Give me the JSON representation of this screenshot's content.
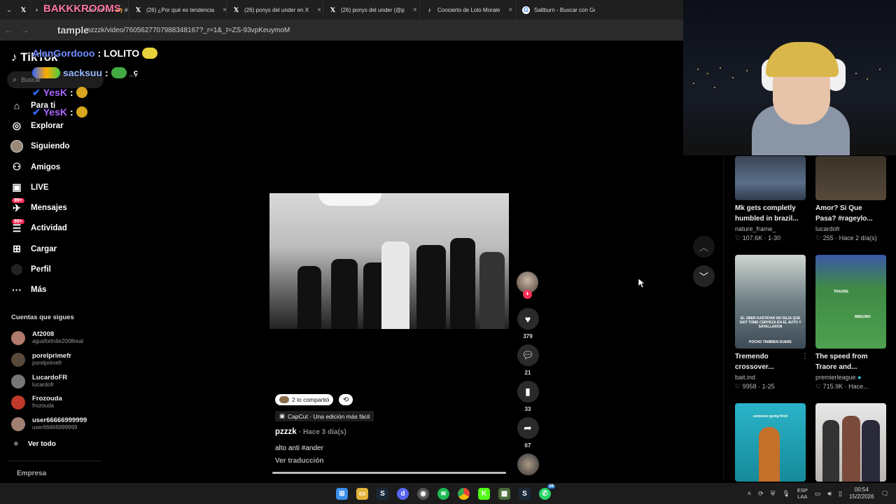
{
  "browser": {
    "tabs": [
      {
        "icon": "x-logo-icon",
        "label": "",
        "color": "#000000"
      },
      {
        "icon": "x-logo-icon",
        "label": "acerobulto 🙌 #en",
        "color": "#000000"
      },
      {
        "icon": "x-logo-icon",
        "label": "(26) ¿Por qué es tendencia",
        "color": "#000000"
      },
      {
        "icon": "x-logo-icon",
        "label": "(26) ponys del under en X",
        "color": "#000000"
      },
      {
        "icon": "x-logo-icon",
        "label": "(26) ponys del under (@p",
        "color": "#000000"
      },
      {
        "icon": "tiktok-icon",
        "label": "Concierto de Lolo Morale",
        "color": "#000000"
      },
      {
        "icon": "google-icon",
        "label": "Saltburn - Buscar con Go",
        "color": "#4285f4"
      }
    ],
    "url": "…pzzzk/video/7605627707988348167?_r=1&_t=ZS-93vpKeuymoM"
  },
  "overlay": {
    "stream_name": "BAKKKROOMS",
    "stream_name2": "tample",
    "chat": [
      {
        "user": "AlanGordooo",
        "message": "LOLITO"
      },
      {
        "user": "sacksuu",
        "message": "_ç"
      },
      {
        "user": "YesK",
        "message": ""
      },
      {
        "user": "YesK",
        "message": ""
      }
    ]
  },
  "sidebar": {
    "logo": "TikTok",
    "search_placeholder": "Buscar",
    "nav": [
      {
        "icon": "home-icon",
        "label": "Para ti",
        "badge": ""
      },
      {
        "icon": "compass-icon",
        "label": "Explorar",
        "badge": ""
      },
      {
        "icon": "avatar-icon",
        "label": "Siguiendo",
        "badge": ""
      },
      {
        "icon": "friends-icon",
        "label": "Amigos",
        "badge": ""
      },
      {
        "icon": "live-icon",
        "label": "LIVE",
        "badge": ""
      },
      {
        "icon": "messages-icon",
        "label": "Mensajes",
        "badge": "99+"
      },
      {
        "icon": "activity-icon",
        "label": "Actividad",
        "badge": "99+"
      },
      {
        "icon": "upload-icon",
        "label": "Cargar",
        "badge": ""
      },
      {
        "icon": "profile-icon",
        "label": "Perfil",
        "badge": ""
      },
      {
        "icon": "more-icon",
        "label": "Más",
        "badge": ""
      }
    ],
    "following_title": "Cuentas que sigues",
    "following": [
      {
        "name": "Af2008",
        "user": "agusfortnite2008real",
        "color": "#b07a6a"
      },
      {
        "name": "porelprimefr",
        "user": "porelprimefr",
        "color": "#5a4a3a"
      },
      {
        "name": "LucardoFR",
        "user": "lucardofr",
        "color": "#777777"
      },
      {
        "name": "Frozouda",
        "user": "frozouda",
        "color": "#c0392b"
      },
      {
        "name": "user66666999999",
        "user": "user66666999999",
        "color": "#a08070"
      }
    ],
    "see_all": "Ver todo",
    "company": "Empresa"
  },
  "video": {
    "shared_text": "2 lo compartió",
    "capcut_text": "CapCut · Una edición más fácil",
    "author": "pzzzk",
    "posted": "· Hace 3 día(s)",
    "caption": "alto anti #ander",
    "translate": "Ver traducción",
    "progress_fraction": 1.0,
    "likes": "379",
    "comments": "21",
    "saves": "33",
    "shares": "67"
  },
  "recommendations": [
    {
      "title": "Mk gets completly humbled in brazil...",
      "user": "nature_frame_",
      "stats": "107.6K · 1-30",
      "verified": false
    },
    {
      "title": "Amor? Si Que Pasa? #rageylo...",
      "user": "lucardofr",
      "stats": "255 · Hace 2 día(s)",
      "verified": false
    },
    {
      "title": "Tremendo crossover...",
      "user": "bait.ind",
      "stats": "9958 · 1-25",
      "verified": false,
      "thumb_text": "EL UBER KASTAYAR NO DEJA QUE SAIT TOME CERVEZA EN EL AUTO Y SATALLARON",
      "thumb_text2": "POCHO TAMBIEN DUERE"
    },
    {
      "title": "The speed from Traore and...",
      "user": "premierleague",
      "stats": "715.9K · Hace...",
      "verified": true,
      "thumb_text": "TRAORE",
      "thumb_text2": "MBEUMO"
    },
    {
      "title": "",
      "user": "",
      "stats": "",
      "verified": false,
      "thumb_text": "someone going fired",
      "thumb_text2": ""
    },
    {
      "title": "",
      "user": "",
      "stats": "",
      "verified": false
    }
  ],
  "taskbar": {
    "lang": "ESP",
    "lang2": "LAA",
    "time": "00:54",
    "date": "15/2/2026",
    "whatsapp_badge": "26"
  }
}
